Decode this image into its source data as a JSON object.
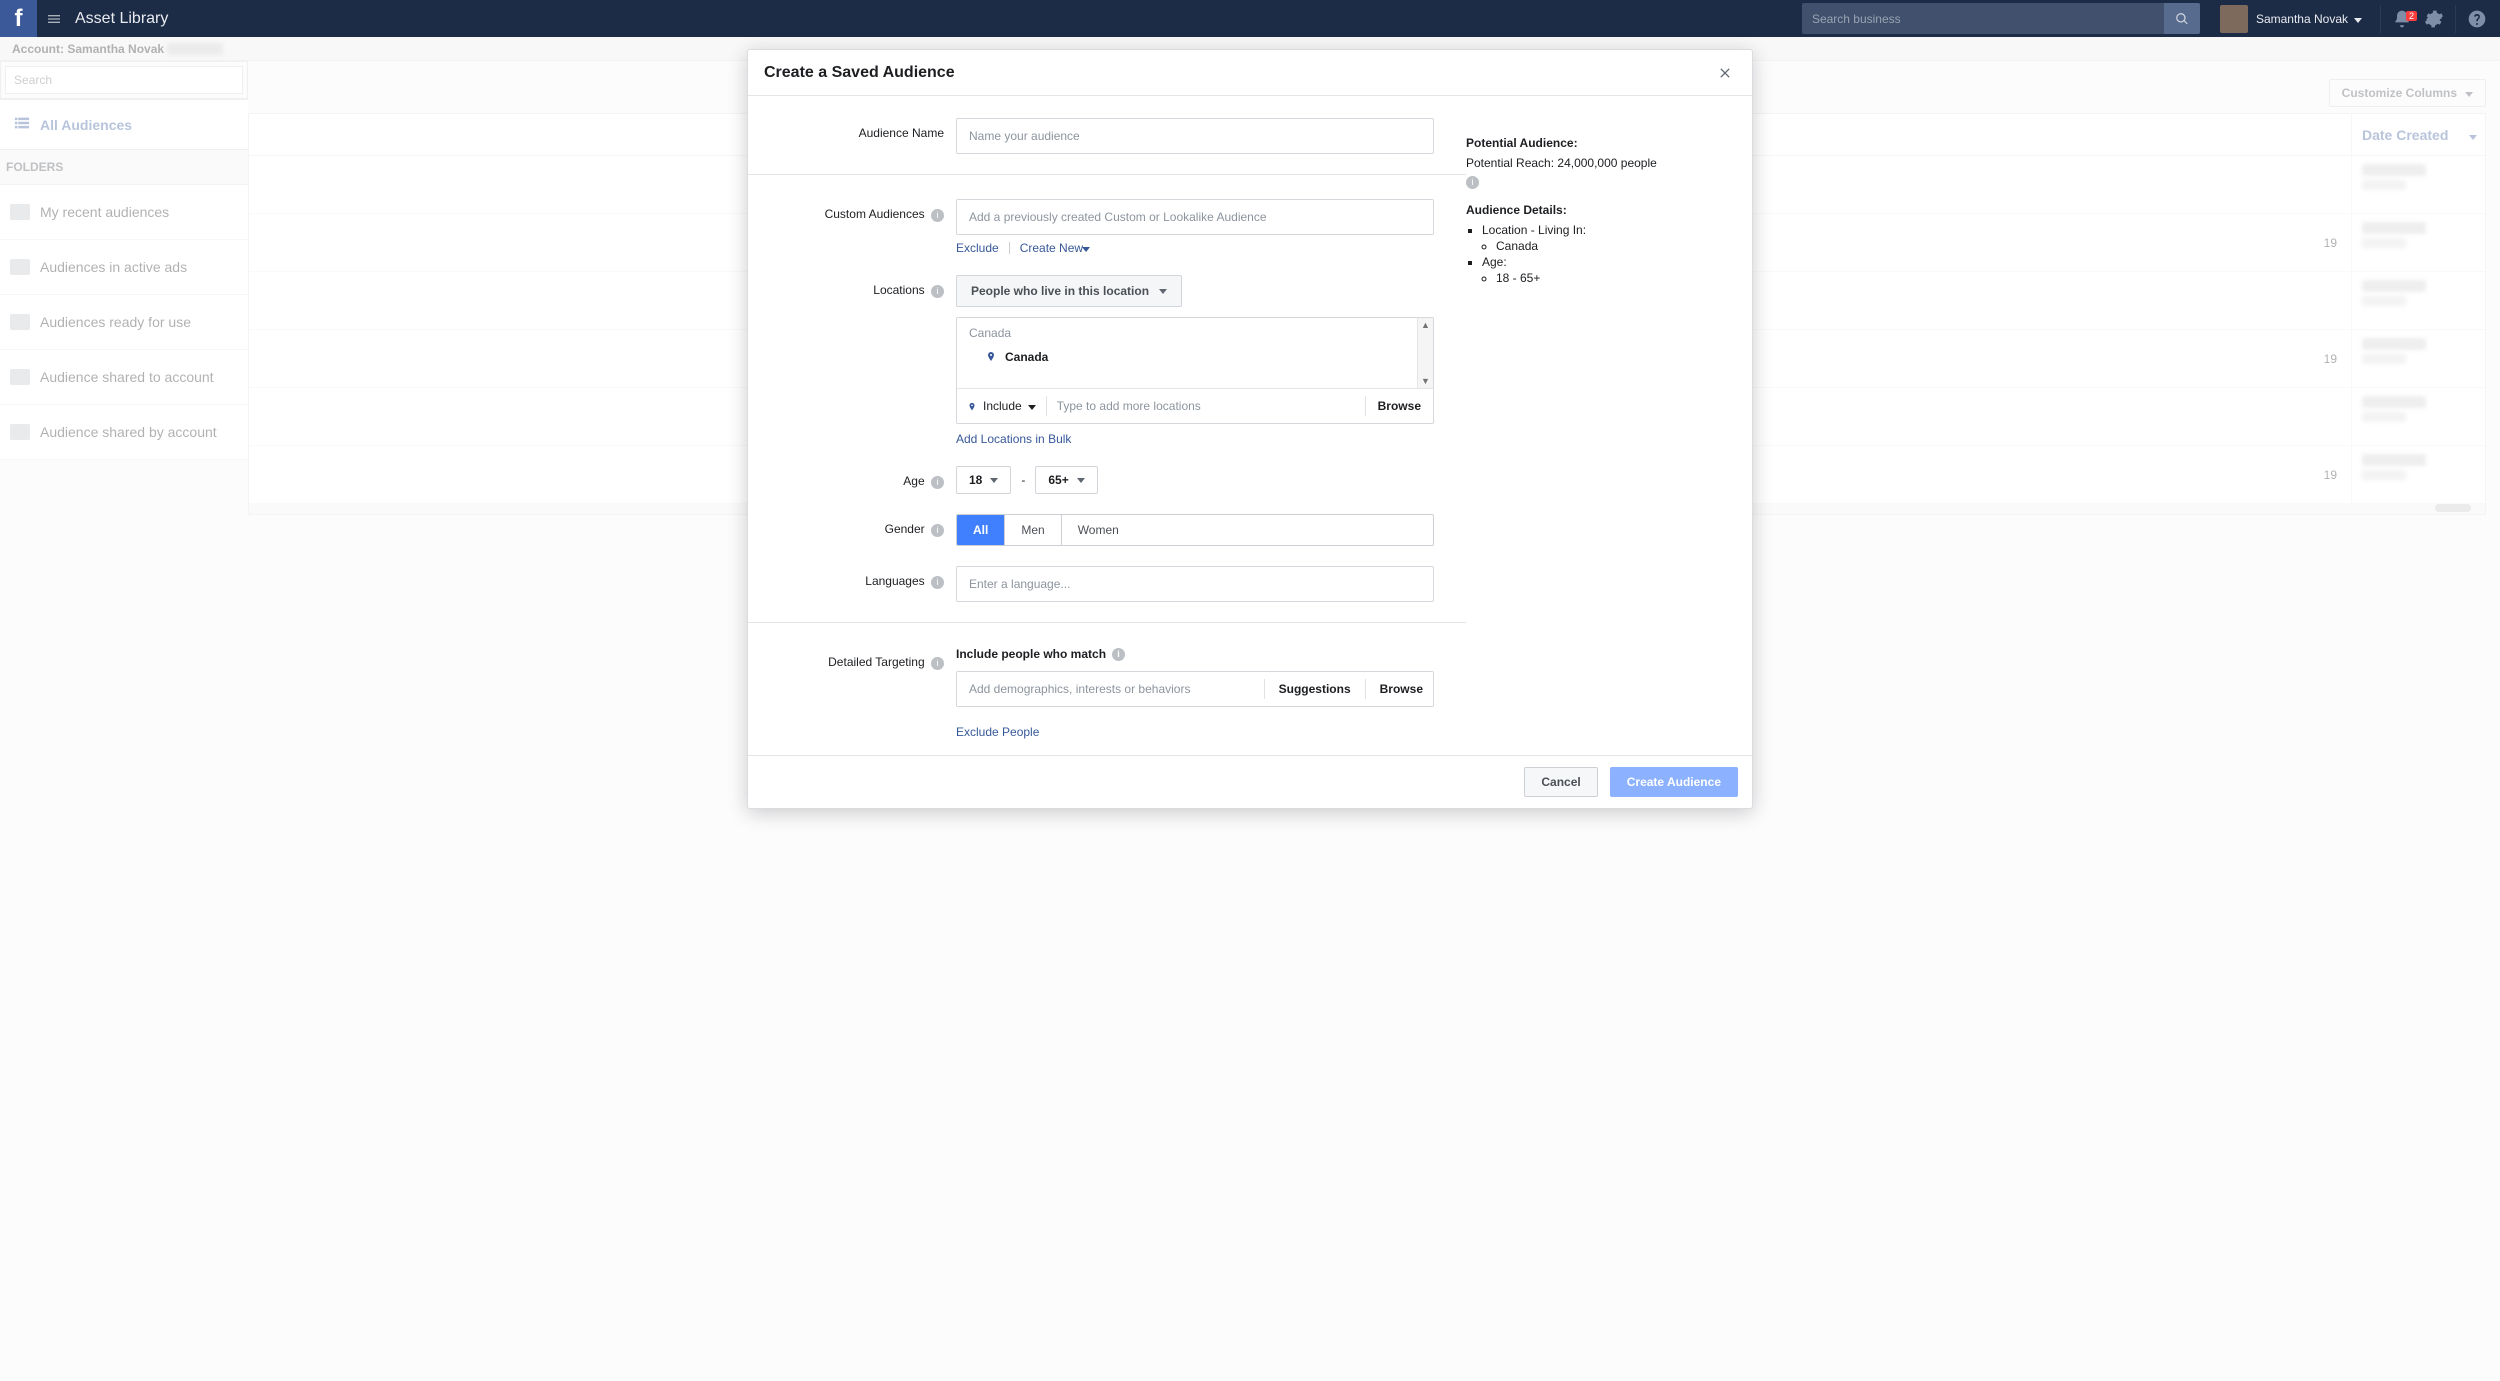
{
  "topnav": {
    "brand": "Asset Library",
    "search_placeholder": "Search business",
    "username": "Samantha Novak",
    "notif_count": "2"
  },
  "accountbar": {
    "prefix": "Account: ",
    "name": "Samantha Novak"
  },
  "sidebar": {
    "search_placeholder": "Search",
    "all_label": "All Audiences",
    "folders_header": "FOLDERS",
    "folders": [
      {
        "label": "My recent audiences"
      },
      {
        "label": "Audiences in active ads"
      },
      {
        "label": "Audiences ready for use"
      },
      {
        "label": "Audience shared to account"
      },
      {
        "label": "Audience shared by account"
      }
    ]
  },
  "grid": {
    "customize": "Customize Columns",
    "col_date": "Date Created",
    "rows_year_suffix": "19"
  },
  "modal": {
    "title": "Create a Saved Audience",
    "labels": {
      "audience_name": "Audience Name",
      "custom_audiences": "Custom Audiences",
      "locations": "Locations",
      "age": "Age",
      "gender": "Gender",
      "languages": "Languages",
      "detailed_targeting": "Detailed Targeting"
    },
    "placeholders": {
      "audience_name": "Name your audience",
      "custom_audiences": "Add a previously created Custom or Lookalike Audience",
      "canada_hint": "Canada",
      "more_locations": "Type to add more locations",
      "languages": "Enter a language...",
      "detailed": "Add demographics, interests or behaviors"
    },
    "links": {
      "exclude": "Exclude",
      "create_new": "Create New",
      "bulk": "Add Locations in Bulk",
      "exclude_people": "Exclude People"
    },
    "location_filter": "People who live in this location",
    "location_selected": "Canada",
    "location_mode": "Include",
    "browse": "Browse",
    "age_min": "18",
    "age_max": "65+",
    "age_sep": "-",
    "gender_options": {
      "all": "All",
      "men": "Men",
      "women": "Women"
    },
    "detailed_heading": "Include people who match",
    "suggestions": "Suggestions",
    "footer": {
      "cancel": "Cancel",
      "create": "Create Audience"
    }
  },
  "potential": {
    "title": "Potential Audience:",
    "reach": "Potential Reach: 24,000,000 people",
    "details_title": "Audience Details:",
    "loc_label": "Location - Living In:",
    "loc_value": "Canada",
    "age_label": "Age:",
    "age_value": "18 - 65+"
  }
}
